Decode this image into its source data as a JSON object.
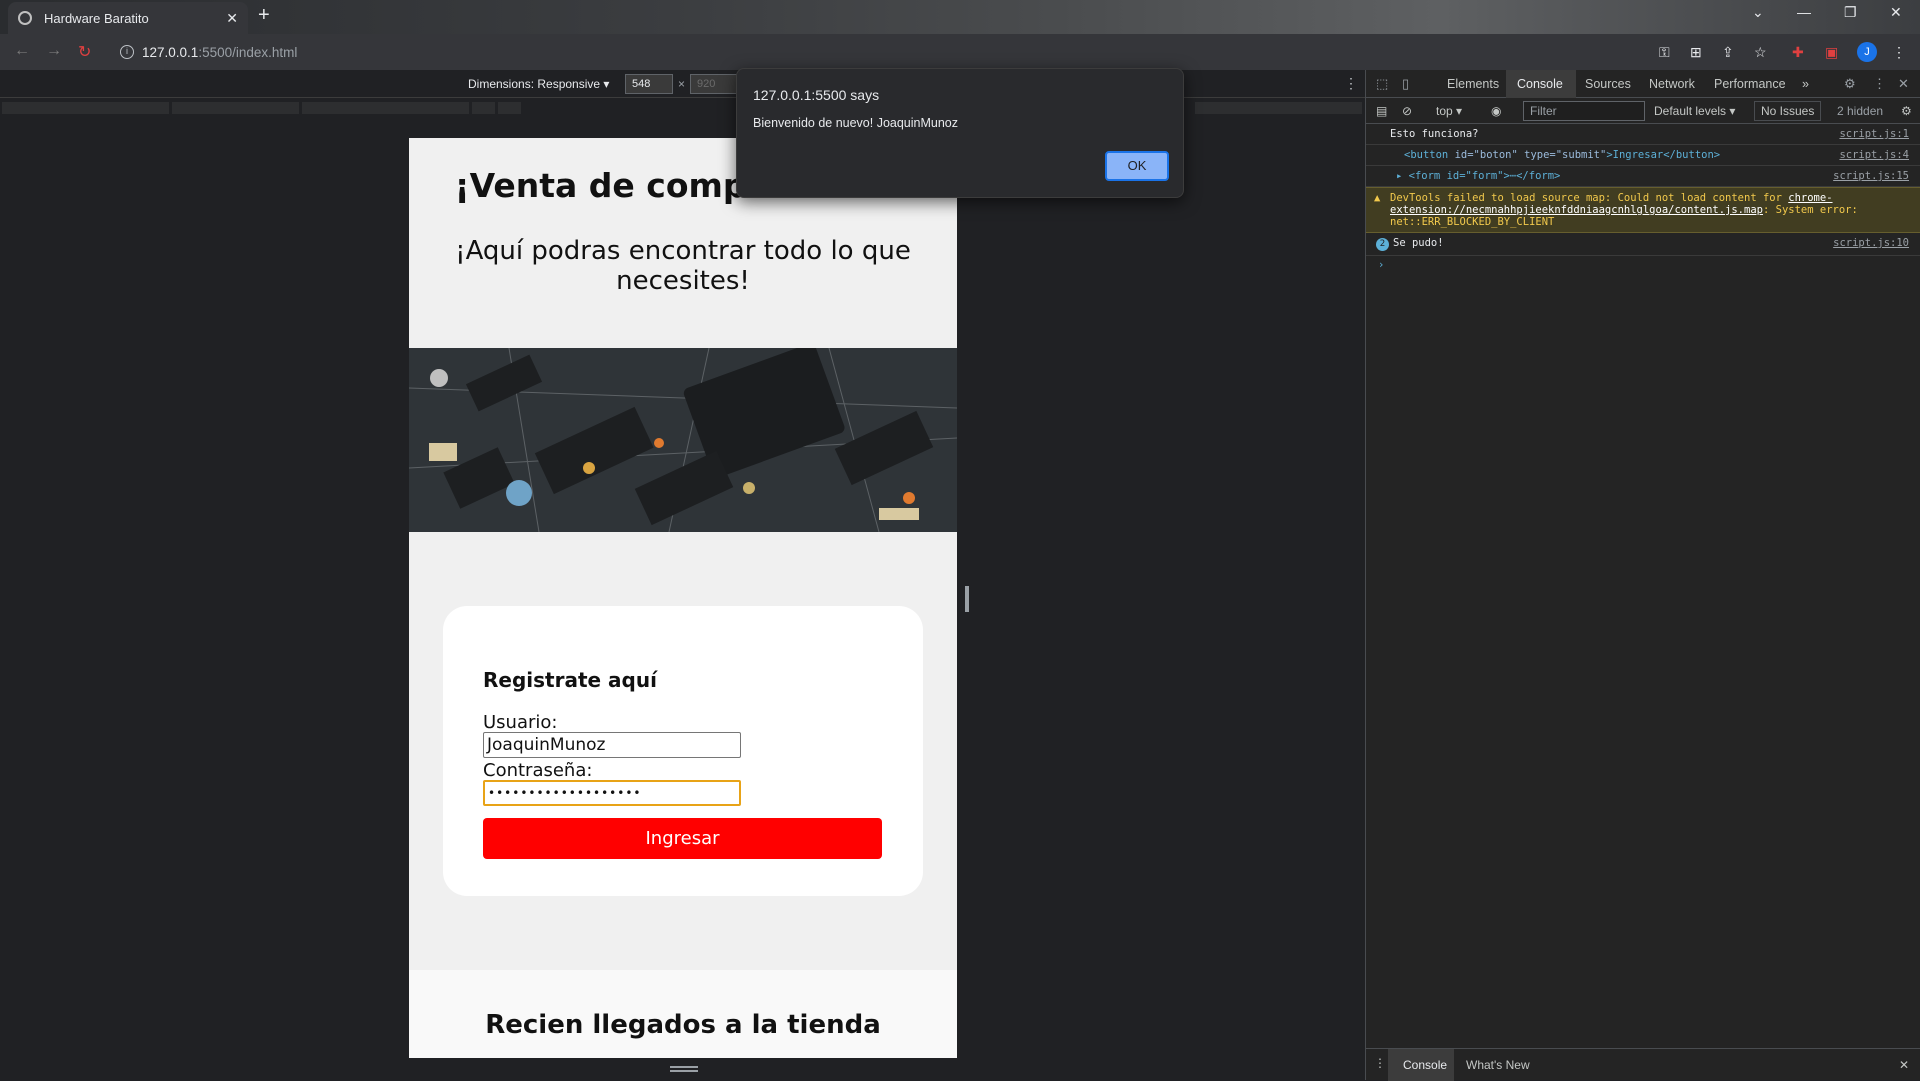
{
  "browser": {
    "tab_title": "Hardware Baratito",
    "tab_close": "✕",
    "new_tab": "+",
    "url_host": "127.0.0.1",
    "url_path": ":5500/index.html",
    "avatar_letter": "J",
    "window_controls": [
      "⌄",
      "—",
      "❐",
      "✕"
    ]
  },
  "device_toolbar": {
    "dimensions_label": "Dimensions: Responsive ▾",
    "width": "548",
    "height": "920",
    "times": "×"
  },
  "page": {
    "heading": "¡Venta de componentes!",
    "subheading": "¡Aquí podras encontrar todo lo que necesites!",
    "form": {
      "title": "Registrate aquí",
      "user_label": "Usuario:",
      "user_value": "JoaquinMunoz",
      "password_label": "Contraseña:",
      "password_value": "•••••••••••••••••••",
      "submit_label": "Ingresar"
    },
    "section2_heading": "Recien llegados a la tienda"
  },
  "alert": {
    "title": "127.0.0.1:5500 says",
    "message": "Bienvenido de nuevo! JoaquinMunoz",
    "ok_label": "OK"
  },
  "devtools": {
    "tabs": [
      "Elements",
      "Console",
      "Sources",
      "Network",
      "Performance",
      "»"
    ],
    "context": "top ▾",
    "filter_placeholder": "Filter",
    "levels": "Default levels ▾",
    "issues": "No Issues",
    "hidden": "2 hidden",
    "console": {
      "log1": "Esto funciona?",
      "log1_src": "script.js:1",
      "log2_open": "<button",
      "log2_attrs": " id=\"boton\" type=\"submit\"",
      "log2_text": ">Ingresar</button>",
      "log2_src": "script.js:4",
      "log3": "▸ <form id=\"form\">⋯</form>",
      "log3_src": "script.js:15",
      "warn_prefix": "DevTools failed to load source map: Could not load content for ",
      "warn_link": "chrome-extension://necmnahhpjieeknfddniaagcnhlglgoa/content.js.map",
      "warn_suffix": ": System error: net::ERR_BLOCKED_BY_CLIENT",
      "log4_count": "2",
      "log4": "Se pudo!",
      "log4_src": "script.js:10",
      "prompt": "›"
    },
    "drawer_tabs": [
      "Console",
      "What's New"
    ],
    "drawer_close": "✕"
  }
}
